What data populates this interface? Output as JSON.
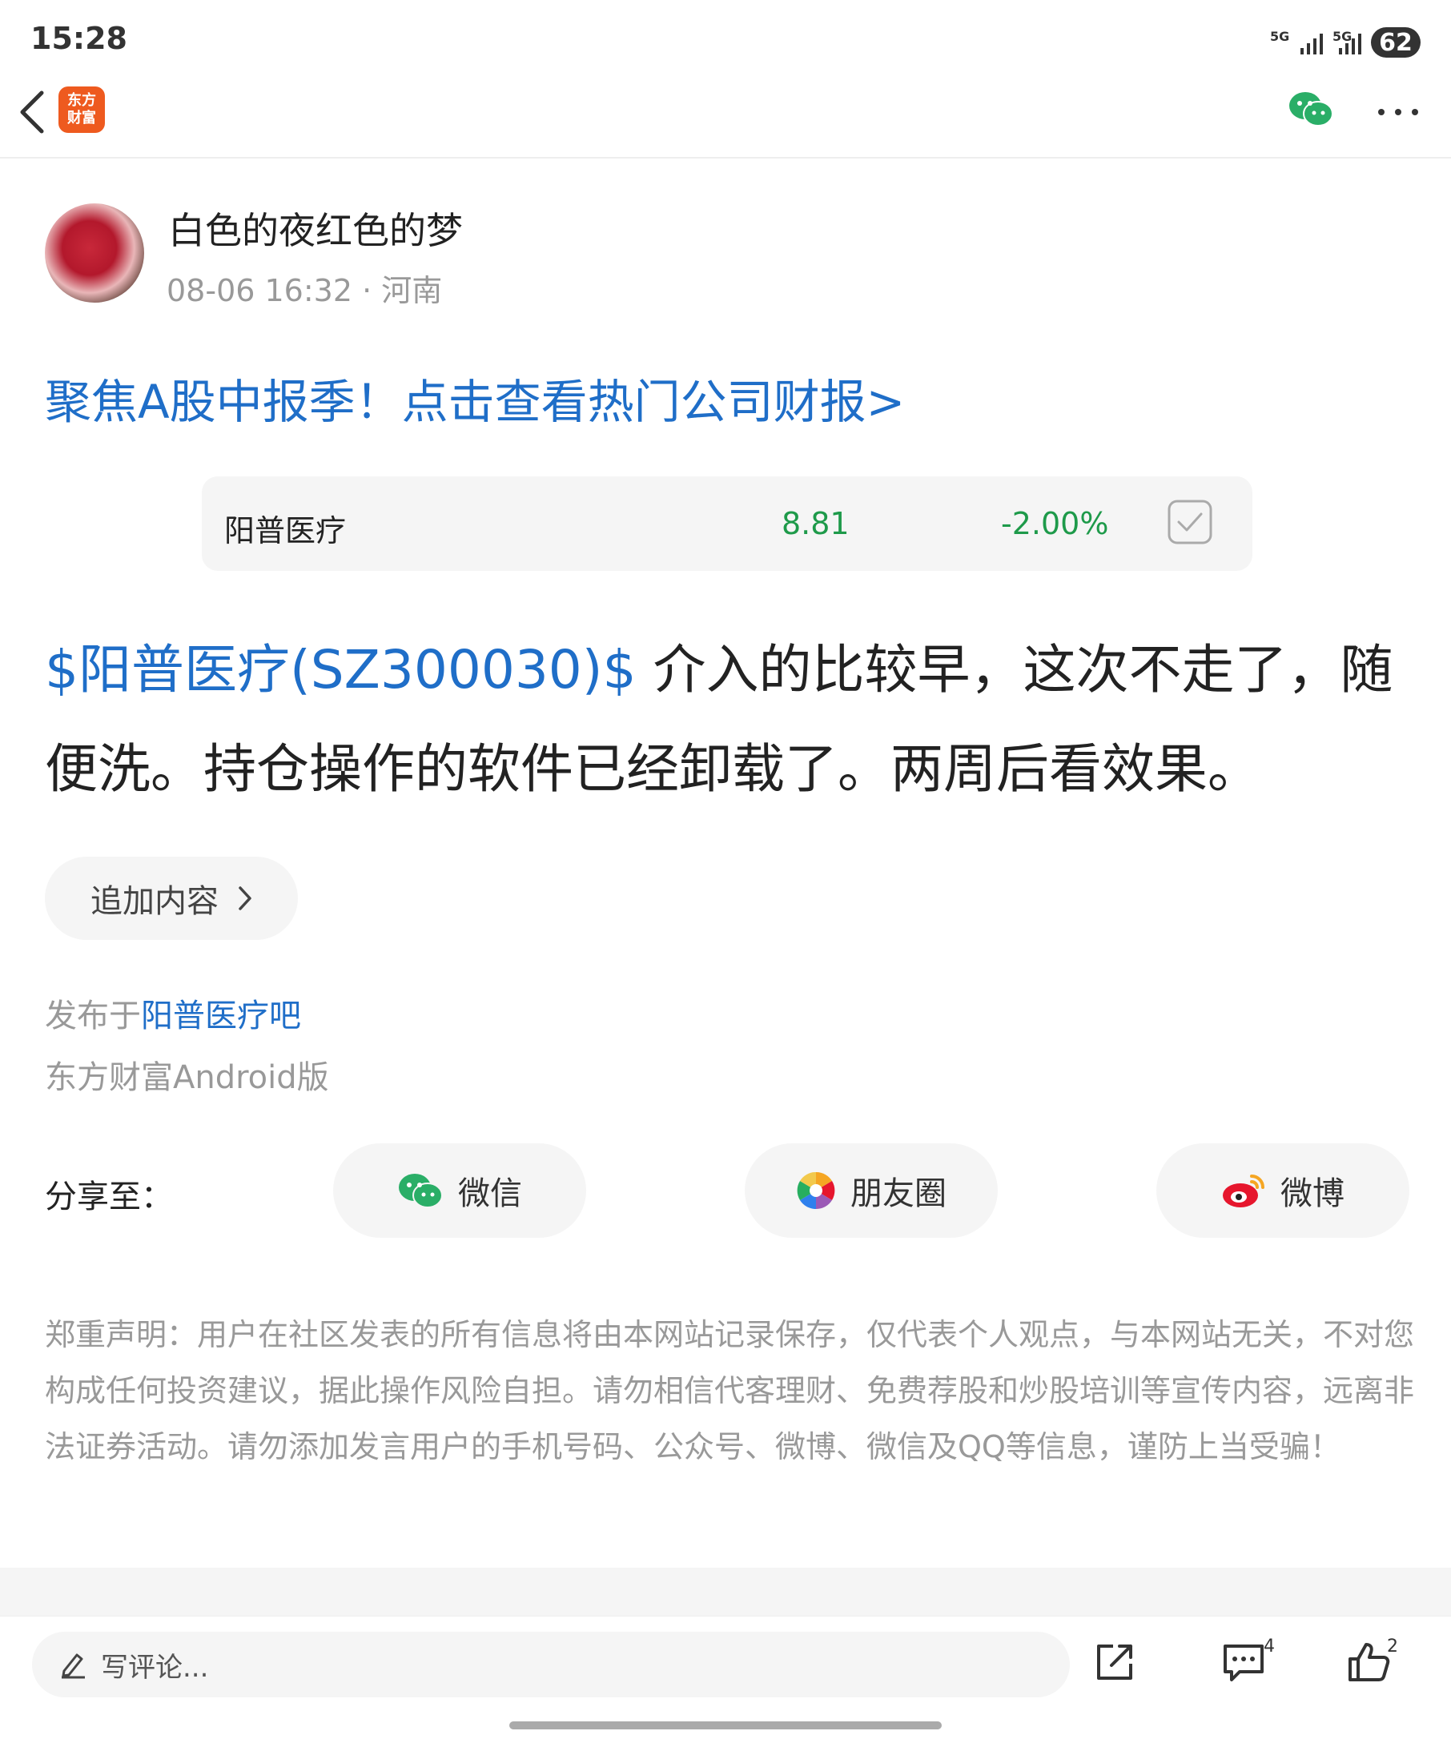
{
  "status_bar": {
    "time": "15:28",
    "signal1": "5G",
    "signal2": "5G",
    "battery": "62"
  },
  "nav": {
    "logo_line1": "东方",
    "logo_line2": "财富"
  },
  "author": {
    "name": "白色的夜红色的梦",
    "meta": "08-06 16:32 · 河南"
  },
  "promo_link": "聚焦A股中报季！点击查看热门公司财报>",
  "stock_card": {
    "name": "阳普医疗",
    "price": "8.81",
    "change": "-2.00%"
  },
  "post": {
    "tag": "$阳普医疗(SZ300030)$",
    "text": " 介入的比较早，这次不走了，随便洗。持仓操作的软件已经卸载了。两周后看效果。"
  },
  "add_content": "追加内容",
  "published": {
    "prefix": "发布于",
    "bar": "阳普医疗吧"
  },
  "client": "东方财富Android版",
  "share": {
    "label": "分享至：",
    "wechat": "微信",
    "moments": "朋友圈",
    "weibo": "微博"
  },
  "disclaimer": "郑重声明：用户在社区发表的所有信息将由本网站记录保存，仅代表个人观点，与本网站无关，不对您构成任何投资建议，据此操作风险自担。请勿相信代客理财、免费荐股和炒股培训等宣传内容，远离非法证券活动。请勿添加发言用户的手机号码、公众号、微博、微信及QQ等信息，谨防上当受骗！",
  "bottom_bar": {
    "comment_placeholder": "写评论...",
    "comment_count": "4",
    "like_count": "2"
  },
  "colors": {
    "link_blue": "#1f6ec8",
    "stock_green": "#1e9a4a",
    "brand_orange": "#ee5a1f",
    "wechat_green": "#2aae67",
    "weibo_red": "#e6162d"
  },
  "icons": [
    "back-chevron-icon",
    "wechat-icon",
    "more-icon",
    "checkbox-icon",
    "chevron-right-icon",
    "moments-icon",
    "weibo-icon",
    "pen-icon",
    "share-out-icon",
    "comment-icon",
    "thumb-up-icon"
  ]
}
